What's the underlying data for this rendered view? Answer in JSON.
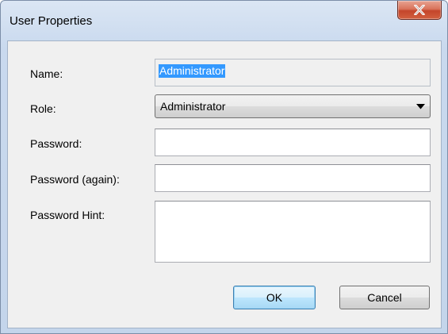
{
  "window": {
    "title": "User Properties",
    "close_symbol": "x"
  },
  "form": {
    "name": {
      "label": "Name:",
      "value": "Administrator"
    },
    "role": {
      "label": "Role:",
      "value": "Administrator"
    },
    "password": {
      "label": "Password:",
      "value": ""
    },
    "password_again": {
      "label": "Password (again):",
      "value": ""
    },
    "password_hint": {
      "label": "Password Hint:",
      "value": ""
    }
  },
  "buttons": {
    "ok_label": "OK",
    "cancel_label": "Cancel"
  },
  "icons": {
    "close": "close-icon",
    "dropdown": "chevron-down-icon"
  },
  "colors": {
    "selection": "#3399ff",
    "close_button": "#c4452b",
    "default_button_border": "#3c7fb1"
  }
}
